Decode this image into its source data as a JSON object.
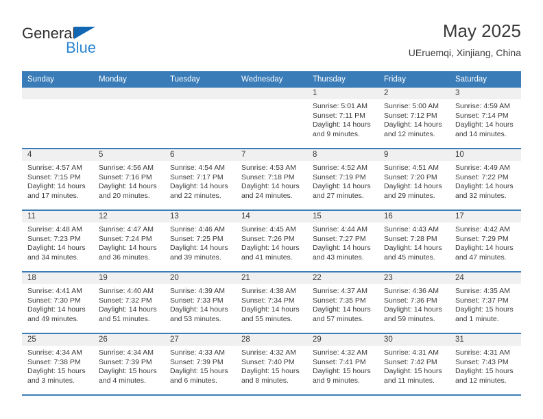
{
  "logo": {
    "word_one": "General",
    "word_two": "Blue",
    "triangle_color": "#1267b2",
    "blue_color": "#2a85d0"
  },
  "header": {
    "title": "May 2025",
    "subtitle": "UEruemqi, Xinjiang, China"
  },
  "theme": {
    "header_bar": "#3a7cb8",
    "cell_head": "#f0f0f0",
    "text": "#3a3a3a"
  },
  "calendar": {
    "weekday_headers": [
      "Sunday",
      "Monday",
      "Tuesday",
      "Wednesday",
      "Thursday",
      "Friday",
      "Saturday"
    ],
    "weeks": [
      [
        {
          "day": "",
          "sunrise": "",
          "sunset": "",
          "daylight": ""
        },
        {
          "day": "",
          "sunrise": "",
          "sunset": "",
          "daylight": ""
        },
        {
          "day": "",
          "sunrise": "",
          "sunset": "",
          "daylight": ""
        },
        {
          "day": "",
          "sunrise": "",
          "sunset": "",
          "daylight": ""
        },
        {
          "day": "1",
          "sunrise": "Sunrise: 5:01 AM",
          "sunset": "Sunset: 7:11 PM",
          "daylight": "Daylight: 14 hours and 9 minutes."
        },
        {
          "day": "2",
          "sunrise": "Sunrise: 5:00 AM",
          "sunset": "Sunset: 7:12 PM",
          "daylight": "Daylight: 14 hours and 12 minutes."
        },
        {
          "day": "3",
          "sunrise": "Sunrise: 4:59 AM",
          "sunset": "Sunset: 7:14 PM",
          "daylight": "Daylight: 14 hours and 14 minutes."
        }
      ],
      [
        {
          "day": "4",
          "sunrise": "Sunrise: 4:57 AM",
          "sunset": "Sunset: 7:15 PM",
          "daylight": "Daylight: 14 hours and 17 minutes."
        },
        {
          "day": "5",
          "sunrise": "Sunrise: 4:56 AM",
          "sunset": "Sunset: 7:16 PM",
          "daylight": "Daylight: 14 hours and 20 minutes."
        },
        {
          "day": "6",
          "sunrise": "Sunrise: 4:54 AM",
          "sunset": "Sunset: 7:17 PM",
          "daylight": "Daylight: 14 hours and 22 minutes."
        },
        {
          "day": "7",
          "sunrise": "Sunrise: 4:53 AM",
          "sunset": "Sunset: 7:18 PM",
          "daylight": "Daylight: 14 hours and 24 minutes."
        },
        {
          "day": "8",
          "sunrise": "Sunrise: 4:52 AM",
          "sunset": "Sunset: 7:19 PM",
          "daylight": "Daylight: 14 hours and 27 minutes."
        },
        {
          "day": "9",
          "sunrise": "Sunrise: 4:51 AM",
          "sunset": "Sunset: 7:20 PM",
          "daylight": "Daylight: 14 hours and 29 minutes."
        },
        {
          "day": "10",
          "sunrise": "Sunrise: 4:49 AM",
          "sunset": "Sunset: 7:22 PM",
          "daylight": "Daylight: 14 hours and 32 minutes."
        }
      ],
      [
        {
          "day": "11",
          "sunrise": "Sunrise: 4:48 AM",
          "sunset": "Sunset: 7:23 PM",
          "daylight": "Daylight: 14 hours and 34 minutes."
        },
        {
          "day": "12",
          "sunrise": "Sunrise: 4:47 AM",
          "sunset": "Sunset: 7:24 PM",
          "daylight": "Daylight: 14 hours and 36 minutes."
        },
        {
          "day": "13",
          "sunrise": "Sunrise: 4:46 AM",
          "sunset": "Sunset: 7:25 PM",
          "daylight": "Daylight: 14 hours and 39 minutes."
        },
        {
          "day": "14",
          "sunrise": "Sunrise: 4:45 AM",
          "sunset": "Sunset: 7:26 PM",
          "daylight": "Daylight: 14 hours and 41 minutes."
        },
        {
          "day": "15",
          "sunrise": "Sunrise: 4:44 AM",
          "sunset": "Sunset: 7:27 PM",
          "daylight": "Daylight: 14 hours and 43 minutes."
        },
        {
          "day": "16",
          "sunrise": "Sunrise: 4:43 AM",
          "sunset": "Sunset: 7:28 PM",
          "daylight": "Daylight: 14 hours and 45 minutes."
        },
        {
          "day": "17",
          "sunrise": "Sunrise: 4:42 AM",
          "sunset": "Sunset: 7:29 PM",
          "daylight": "Daylight: 14 hours and 47 minutes."
        }
      ],
      [
        {
          "day": "18",
          "sunrise": "Sunrise: 4:41 AM",
          "sunset": "Sunset: 7:30 PM",
          "daylight": "Daylight: 14 hours and 49 minutes."
        },
        {
          "day": "19",
          "sunrise": "Sunrise: 4:40 AM",
          "sunset": "Sunset: 7:32 PM",
          "daylight": "Daylight: 14 hours and 51 minutes."
        },
        {
          "day": "20",
          "sunrise": "Sunrise: 4:39 AM",
          "sunset": "Sunset: 7:33 PM",
          "daylight": "Daylight: 14 hours and 53 minutes."
        },
        {
          "day": "21",
          "sunrise": "Sunrise: 4:38 AM",
          "sunset": "Sunset: 7:34 PM",
          "daylight": "Daylight: 14 hours and 55 minutes."
        },
        {
          "day": "22",
          "sunrise": "Sunrise: 4:37 AM",
          "sunset": "Sunset: 7:35 PM",
          "daylight": "Daylight: 14 hours and 57 minutes."
        },
        {
          "day": "23",
          "sunrise": "Sunrise: 4:36 AM",
          "sunset": "Sunset: 7:36 PM",
          "daylight": "Daylight: 14 hours and 59 minutes."
        },
        {
          "day": "24",
          "sunrise": "Sunrise: 4:35 AM",
          "sunset": "Sunset: 7:37 PM",
          "daylight": "Daylight: 15 hours and 1 minute."
        }
      ],
      [
        {
          "day": "25",
          "sunrise": "Sunrise: 4:34 AM",
          "sunset": "Sunset: 7:38 PM",
          "daylight": "Daylight: 15 hours and 3 minutes."
        },
        {
          "day": "26",
          "sunrise": "Sunrise: 4:34 AM",
          "sunset": "Sunset: 7:39 PM",
          "daylight": "Daylight: 15 hours and 4 minutes."
        },
        {
          "day": "27",
          "sunrise": "Sunrise: 4:33 AM",
          "sunset": "Sunset: 7:39 PM",
          "daylight": "Daylight: 15 hours and 6 minutes."
        },
        {
          "day": "28",
          "sunrise": "Sunrise: 4:32 AM",
          "sunset": "Sunset: 7:40 PM",
          "daylight": "Daylight: 15 hours and 8 minutes."
        },
        {
          "day": "29",
          "sunrise": "Sunrise: 4:32 AM",
          "sunset": "Sunset: 7:41 PM",
          "daylight": "Daylight: 15 hours and 9 minutes."
        },
        {
          "day": "30",
          "sunrise": "Sunrise: 4:31 AM",
          "sunset": "Sunset: 7:42 PM",
          "daylight": "Daylight: 15 hours and 11 minutes."
        },
        {
          "day": "31",
          "sunrise": "Sunrise: 4:31 AM",
          "sunset": "Sunset: 7:43 PM",
          "daylight": "Daylight: 15 hours and 12 minutes."
        }
      ]
    ]
  }
}
